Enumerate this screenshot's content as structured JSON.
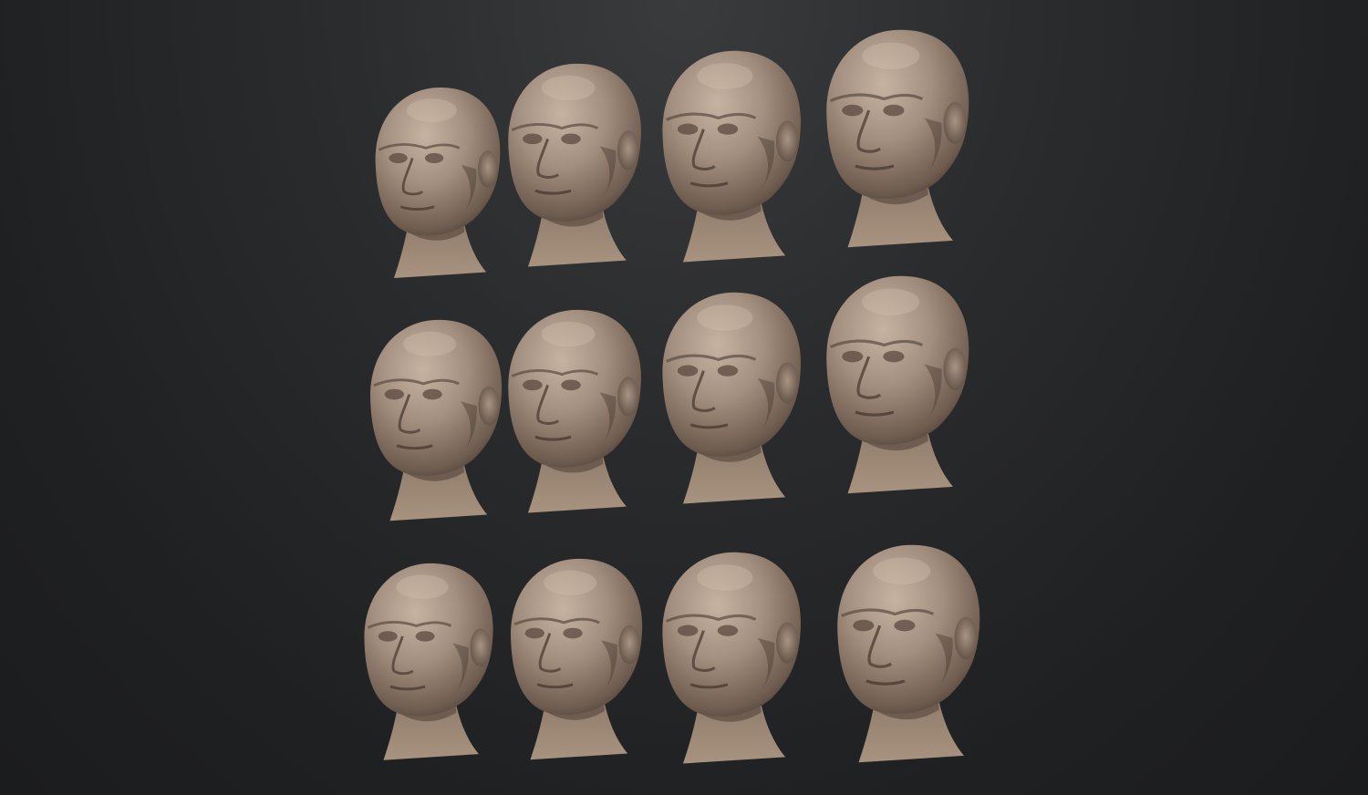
{
  "scene": {
    "background_color": "#242527",
    "material_color": "#a08c7c",
    "material_highlight": "#c3b09f",
    "material_shadow": "#5e4e43"
  },
  "heads": [
    {
      "id": "head-r1-c1",
      "row": 1,
      "col": 1,
      "facing": "left"
    },
    {
      "id": "head-r1-c2",
      "row": 1,
      "col": 2,
      "facing": "left"
    },
    {
      "id": "head-r1-c3",
      "row": 1,
      "col": 3,
      "facing": "left"
    },
    {
      "id": "head-r1-c4",
      "row": 1,
      "col": 4,
      "facing": "left"
    },
    {
      "id": "head-r2-c1",
      "row": 2,
      "col": 1,
      "facing": "left"
    },
    {
      "id": "head-r2-c2",
      "row": 2,
      "col": 2,
      "facing": "left"
    },
    {
      "id": "head-r2-c3",
      "row": 2,
      "col": 3,
      "facing": "left"
    },
    {
      "id": "head-r2-c4",
      "row": 2,
      "col": 4,
      "facing": "left"
    },
    {
      "id": "head-r3-c1",
      "row": 3,
      "col": 1,
      "facing": "left"
    },
    {
      "id": "head-r3-c2",
      "row": 3,
      "col": 2,
      "facing": "left"
    },
    {
      "id": "head-r3-c3",
      "row": 3,
      "col": 3,
      "facing": "left"
    },
    {
      "id": "head-r3-c4",
      "row": 3,
      "col": 4,
      "facing": "left"
    }
  ]
}
